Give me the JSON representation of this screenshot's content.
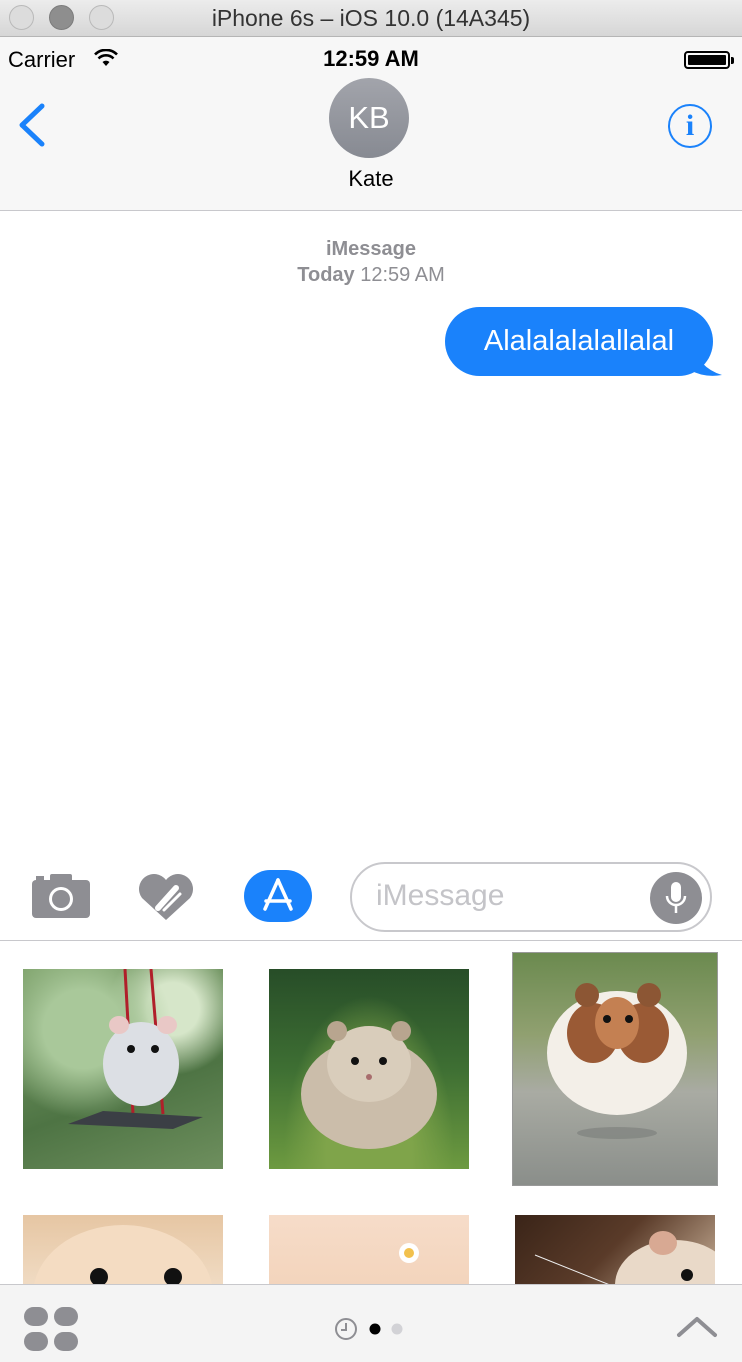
{
  "window": {
    "title": "iPhone 6s – iOS 10.0 (14A345)"
  },
  "status_bar": {
    "carrier": "Carrier",
    "time": "12:59 AM"
  },
  "nav": {
    "avatar_initials": "KB",
    "contact_name": "Kate",
    "info_glyph": "i"
  },
  "conversation": {
    "service": "iMessage",
    "timestamp_day": "Today",
    "timestamp_time": "12:59 AM",
    "messages": [
      {
        "text": "Alalalalalallalal",
        "direction": "outgoing"
      }
    ]
  },
  "input": {
    "placeholder": "iMessage"
  },
  "stickers": [
    {
      "subject": "hamster on a swing"
    },
    {
      "subject": "grey hamster on grass"
    },
    {
      "subject": "hamster running"
    },
    {
      "subject": "hamster face close-up"
    },
    {
      "subject": "hamster with flower"
    },
    {
      "subject": "hamster with whiskers"
    }
  ],
  "colors": {
    "accent": "#1a82fb",
    "secondary_text": "#8e8e93",
    "icon_grey": "#8e8e93"
  },
  "icons": [
    "back-chevron-icon",
    "info-icon",
    "wifi-icon",
    "battery-icon",
    "camera-icon",
    "digital-touch-icon",
    "app-store-icon",
    "microphone-icon",
    "app-drawer-grid-icon",
    "recents-clock-icon",
    "expand-chevron-up-icon"
  ]
}
